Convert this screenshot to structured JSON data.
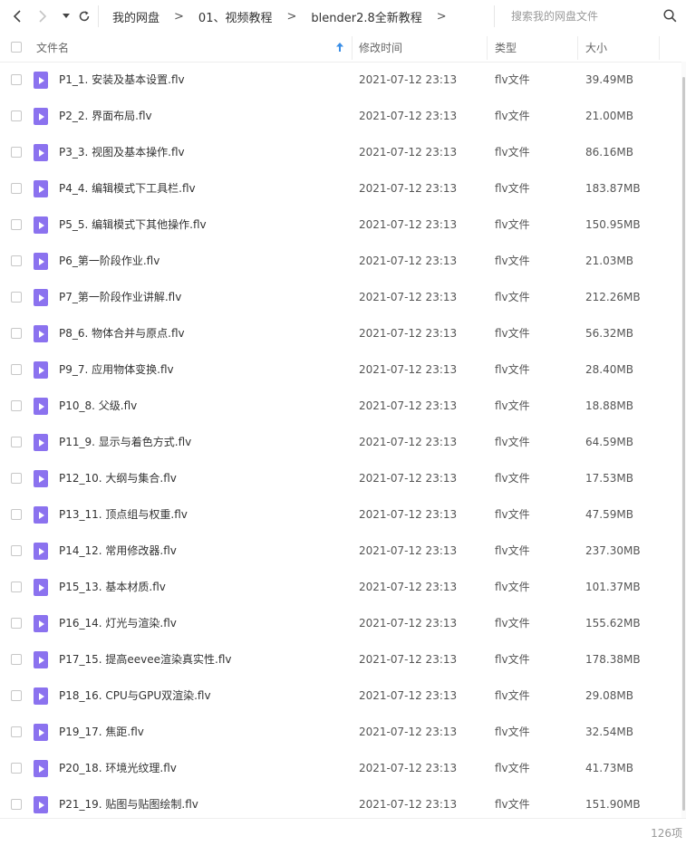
{
  "breadcrumb": [
    "我的网盘",
    "01、视频教程",
    "blender2.8全新教程"
  ],
  "breadcrumb_arrow": ">",
  "search": {
    "placeholder": "搜索我的网盘文件"
  },
  "columns": {
    "name": "文件名",
    "modified": "修改时间",
    "type": "类型",
    "size": "大小"
  },
  "files": [
    {
      "name": "P1_1. 安装及基本设置.flv",
      "modified": "2021-07-12 23:13",
      "type": "flv文件",
      "size": "39.49MB"
    },
    {
      "name": "P2_2. 界面布局.flv",
      "modified": "2021-07-12 23:13",
      "type": "flv文件",
      "size": "21.00MB"
    },
    {
      "name": "P3_3. 视图及基本操作.flv",
      "modified": "2021-07-12 23:13",
      "type": "flv文件",
      "size": "86.16MB"
    },
    {
      "name": "P4_4. 编辑模式下工具栏.flv",
      "modified": "2021-07-12 23:13",
      "type": "flv文件",
      "size": "183.87MB"
    },
    {
      "name": "P5_5. 编辑模式下其他操作.flv",
      "modified": "2021-07-12 23:13",
      "type": "flv文件",
      "size": "150.95MB"
    },
    {
      "name": "P6_第一阶段作业.flv",
      "modified": "2021-07-12 23:13",
      "type": "flv文件",
      "size": "21.03MB"
    },
    {
      "name": "P7_第一阶段作业讲解.flv",
      "modified": "2021-07-12 23:13",
      "type": "flv文件",
      "size": "212.26MB"
    },
    {
      "name": "P8_6. 物体合并与原点.flv",
      "modified": "2021-07-12 23:13",
      "type": "flv文件",
      "size": "56.32MB"
    },
    {
      "name": "P9_7. 应用物体变换.flv",
      "modified": "2021-07-12 23:13",
      "type": "flv文件",
      "size": "28.40MB"
    },
    {
      "name": "P10_8. 父级.flv",
      "modified": "2021-07-12 23:13",
      "type": "flv文件",
      "size": "18.88MB"
    },
    {
      "name": "P11_9. 显示与着色方式.flv",
      "modified": "2021-07-12 23:13",
      "type": "flv文件",
      "size": "64.59MB"
    },
    {
      "name": "P12_10. 大纲与集合.flv",
      "modified": "2021-07-12 23:13",
      "type": "flv文件",
      "size": "17.53MB"
    },
    {
      "name": "P13_11. 顶点组与权重.flv",
      "modified": "2021-07-12 23:13",
      "type": "flv文件",
      "size": "47.59MB"
    },
    {
      "name": "P14_12. 常用修改器.flv",
      "modified": "2021-07-12 23:13",
      "type": "flv文件",
      "size": "237.30MB"
    },
    {
      "name": "P15_13. 基本材质.flv",
      "modified": "2021-07-12 23:13",
      "type": "flv文件",
      "size": "101.37MB"
    },
    {
      "name": "P16_14. 灯光与渲染.flv",
      "modified": "2021-07-12 23:13",
      "type": "flv文件",
      "size": "155.62MB"
    },
    {
      "name": "P17_15. 提高eevee渲染真实性.flv",
      "modified": "2021-07-12 23:13",
      "type": "flv文件",
      "size": "178.38MB"
    },
    {
      "name": "P18_16. CPU与GPU双渲染.flv",
      "modified": "2021-07-12 23:13",
      "type": "flv文件",
      "size": "29.08MB"
    },
    {
      "name": "P19_17. 焦距.flv",
      "modified": "2021-07-12 23:13",
      "type": "flv文件",
      "size": "32.54MB"
    },
    {
      "name": "P20_18. 环境光纹理.flv",
      "modified": "2021-07-12 23:13",
      "type": "flv文件",
      "size": "41.73MB"
    },
    {
      "name": "P21_19. 贴图与贴图绘制.flv",
      "modified": "2021-07-12 23:13",
      "type": "flv文件",
      "size": "151.90MB"
    }
  ],
  "footer": {
    "count": "126项"
  },
  "colors": {
    "file_icon": "#8b72ef",
    "sort_arrow": "#3a8ee6"
  },
  "icons": [
    "back-icon",
    "forward-icon",
    "history-dropdown-icon",
    "refresh-icon",
    "search-icon",
    "sort-arrow-icon",
    "video-file-icon"
  ]
}
